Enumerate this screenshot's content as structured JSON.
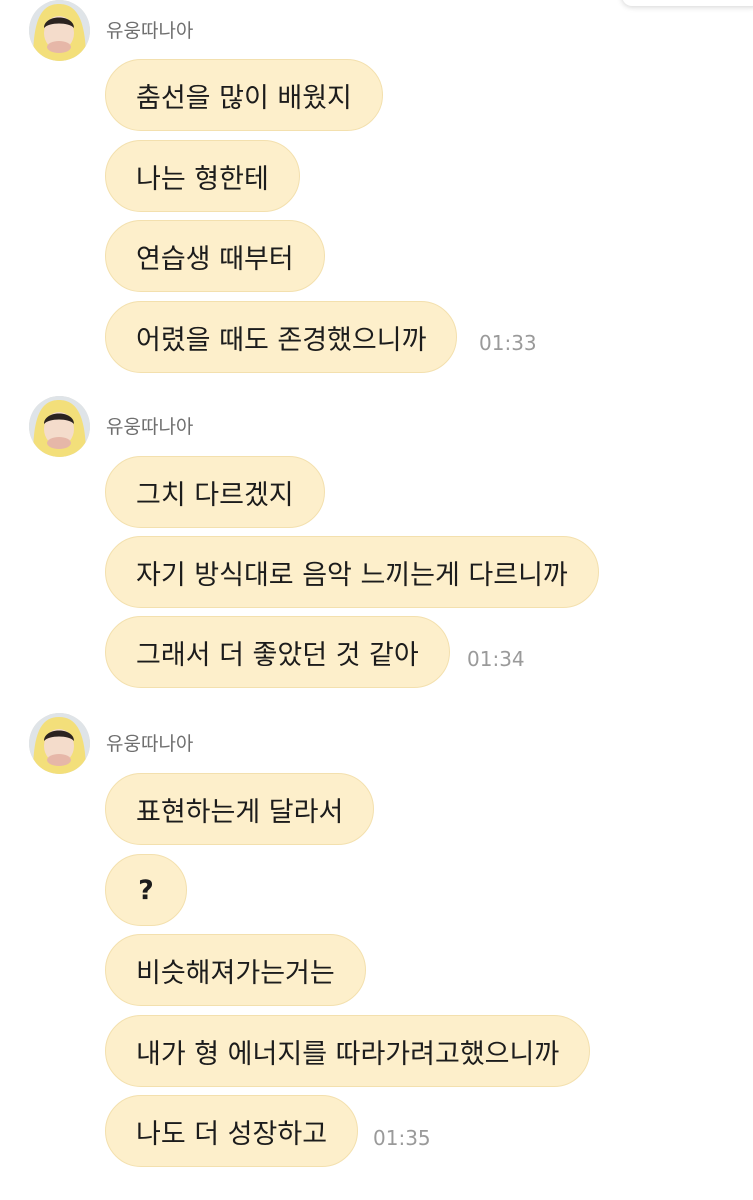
{
  "groups": [
    {
      "sender": "유웅따나아",
      "messages": [
        "춤선을 많이 배웠지",
        "나는 형한테",
        "연습생 때부터",
        "어렸을 때도 존경했으니까"
      ],
      "time": "01:33"
    },
    {
      "sender": "유웅따나아",
      "messages": [
        "그치 다르겠지",
        "자기 방식대로 음악 느끼는게 다르니까",
        "그래서 더 좋았던 것 같아"
      ],
      "time": "01:34"
    },
    {
      "sender": "유웅따나아",
      "messages": [
        "표현하는게 달라서",
        "?",
        "비슷해져가는거는",
        "내가 형 에너지를 따라가려고했으니까",
        "나도 더 성장하고"
      ],
      "time": "01:35"
    }
  ],
  "colors": {
    "bubble": "#fdefcb",
    "bubble_border": "#f3e0ae",
    "avatar_hood": "#f3df7a"
  },
  "icons": {
    "avatar": "profile-photo-yellow-hood"
  }
}
